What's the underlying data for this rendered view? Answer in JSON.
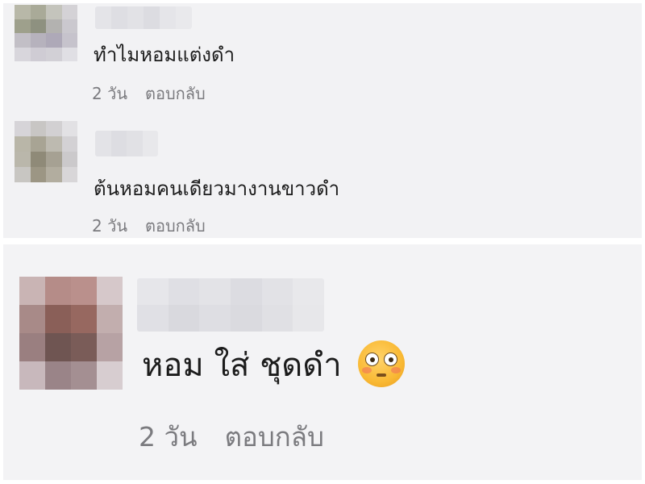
{
  "comments_top": [
    {
      "text": "ทำไมหอมแต่งดำ",
      "time": "2 วัน",
      "reply": "ตอบกลับ"
    },
    {
      "text": "ต้นหอมคนเดียวมางานขาวดำ",
      "time": "2 วัน",
      "reply": "ตอบกลับ"
    }
  ],
  "comment_bottom": {
    "text": "หอม ใส่ ชุดดำ",
    "emoji": "flushed-face-icon",
    "time": "2 วัน",
    "reply": "ตอบกลับ"
  },
  "colors": {
    "panel_background": "#f2f2f4",
    "text": "#1c1c1c",
    "meta_text": "#7b7b7f"
  }
}
